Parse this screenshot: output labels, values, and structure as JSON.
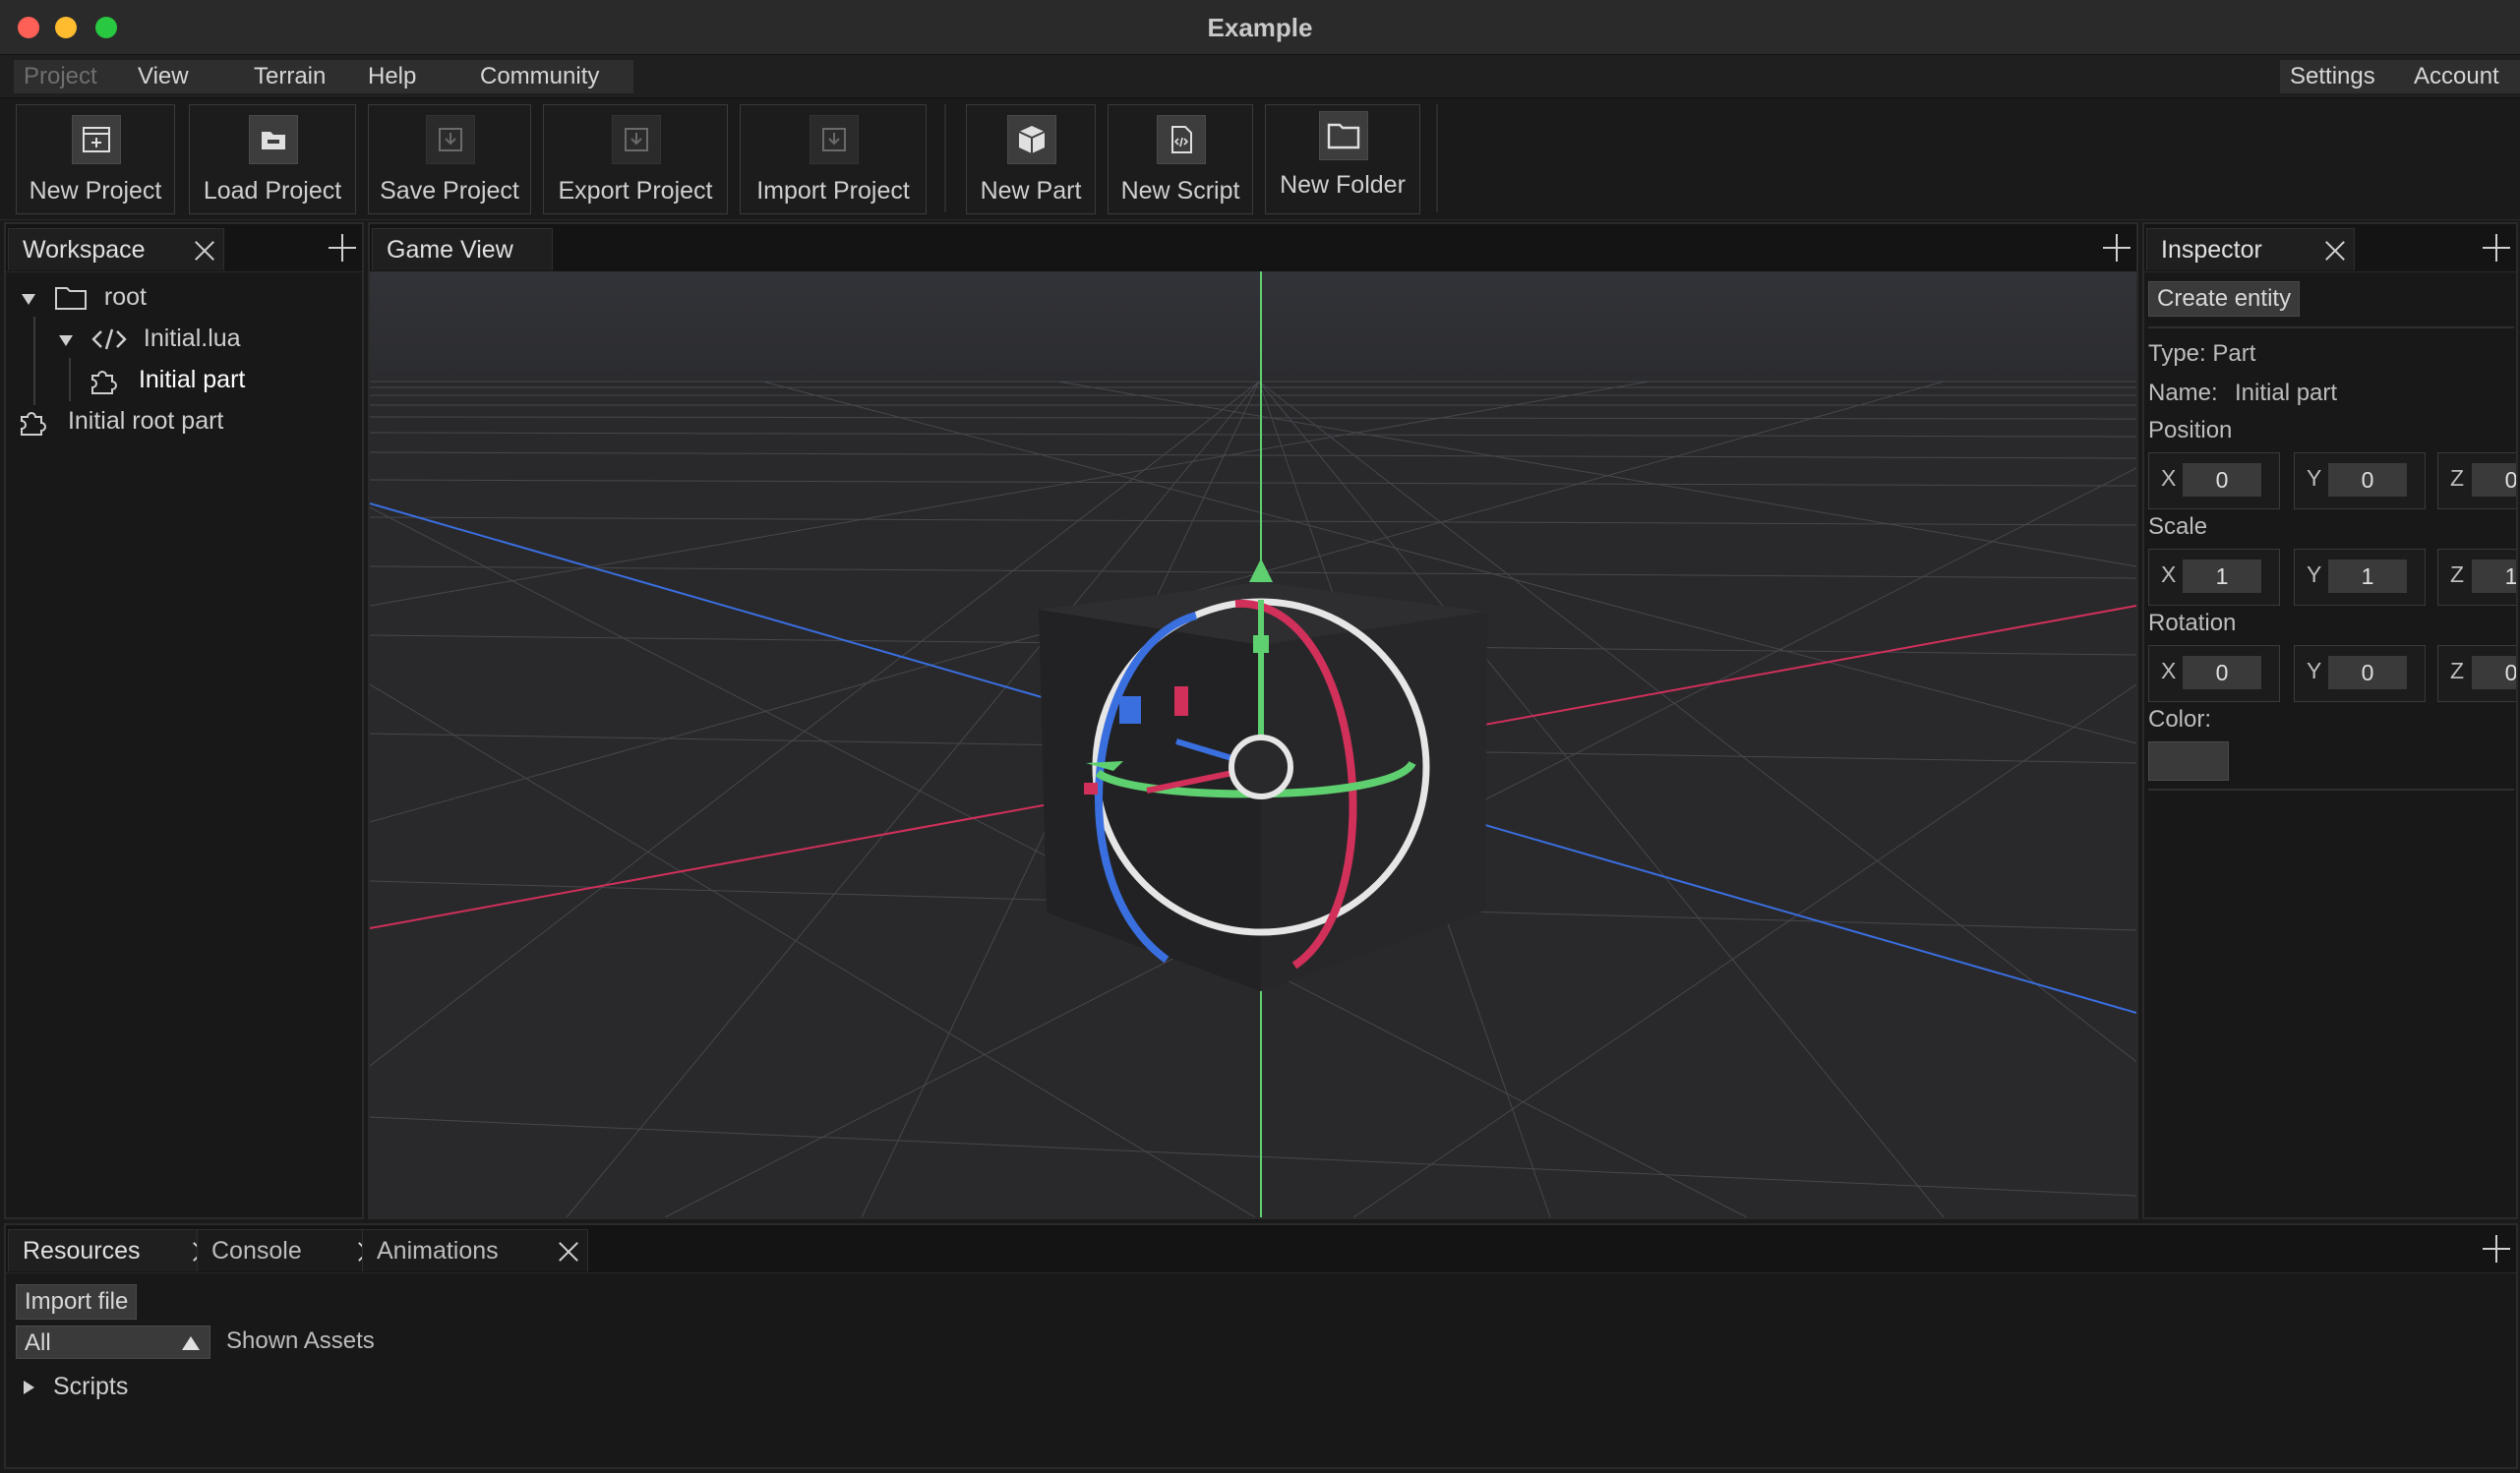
{
  "window": {
    "title": "Example"
  },
  "menu": {
    "project": "Project",
    "view": "View",
    "terrain": "Terrain",
    "help": "Help",
    "community": "Community",
    "settings": "Settings",
    "account": "Account"
  },
  "toolbar": {
    "new_project": "New Project",
    "load_project": "Load Project",
    "save_project": "Save Project",
    "export_project": "Export Project",
    "import_project": "Import Project",
    "new_part": "New Part",
    "new_script": "New Script",
    "new_folder": "New Folder"
  },
  "workspace": {
    "tab": "Workspace",
    "tree": {
      "root": "root",
      "script": "Initial.lua",
      "part": "Initial part",
      "root_part": "Initial root part"
    }
  },
  "game_view": {
    "tab": "Game View"
  },
  "inspector": {
    "tab": "Inspector",
    "create_entity": "Create entity",
    "type": "Type: Part",
    "name_label": "Name:",
    "name_value": "Initial part",
    "position_label": "Position",
    "scale_label": "Scale",
    "rotation_label": "Rotation",
    "color_label": "Color:",
    "axis": {
      "x": "X",
      "y": "Y",
      "z": "Z"
    },
    "position": {
      "x": "0",
      "y": "0",
      "z": "0"
    },
    "scale": {
      "x": "1",
      "y": "1",
      "z": "1"
    },
    "rotation": {
      "x": "0",
      "y": "0",
      "z": "0"
    }
  },
  "bottom": {
    "tabs": {
      "resources": "Resources",
      "console": "Console",
      "animations": "Animations"
    },
    "import_file": "Import file",
    "filter_value": "All",
    "shown_assets": "Shown Assets",
    "scripts": "Scripts"
  },
  "colors": {
    "axis_x": "#d0305a",
    "axis_y": "#5fd070",
    "axis_z": "#3a6fe0"
  }
}
